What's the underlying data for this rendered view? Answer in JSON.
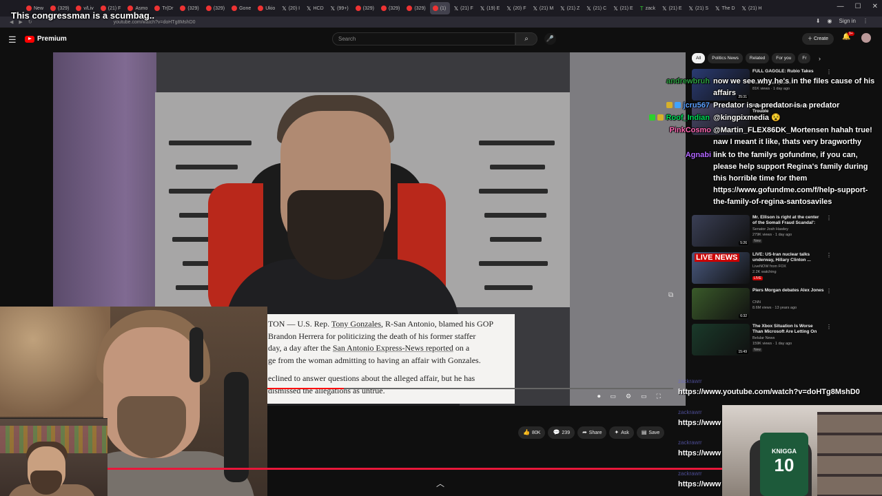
{
  "browser": {
    "tabs": [
      {
        "label": "New",
        "icon": "youtube-icon"
      },
      {
        "label": "(329)",
        "icon": "youtube-icon"
      },
      {
        "label": "v/Liv",
        "icon": "youtube-icon"
      },
      {
        "label": "(21) F",
        "icon": "youtube-icon"
      },
      {
        "label": "Asmo",
        "icon": "youtube-icon"
      },
      {
        "label": "Tr(Dr",
        "icon": "youtube-icon"
      },
      {
        "label": "(329)",
        "icon": "youtube-icon"
      },
      {
        "label": "(329)",
        "icon": "youtube-icon"
      },
      {
        "label": "Gone",
        "icon": "youtube-icon"
      },
      {
        "label": "Ukio",
        "icon": "youtube-icon"
      },
      {
        "label": "(20) I",
        "icon": "x-icon"
      },
      {
        "label": "HCD",
        "icon": "x-icon"
      },
      {
        "label": "(99+)",
        "icon": "x-icon"
      },
      {
        "label": "(329)",
        "icon": "youtube-icon"
      },
      {
        "label": "(329)",
        "icon": "youtube-icon"
      },
      {
        "label": "(329)",
        "icon": "youtube-icon"
      },
      {
        "label": "(1)",
        "icon": "youtube-icon",
        "active": true
      },
      {
        "label": "(21) F",
        "icon": "x-icon"
      },
      {
        "label": "(19) E",
        "icon": "x-icon"
      },
      {
        "label": "(20) F",
        "icon": "x-icon"
      },
      {
        "label": "(21) M",
        "icon": "x-icon"
      },
      {
        "label": "(21) Z",
        "icon": "x-icon"
      },
      {
        "label": "(21) C",
        "icon": "x-icon"
      },
      {
        "label": "(21) E",
        "icon": "x-icon"
      },
      {
        "label": "zack",
        "icon": "tt-icon"
      },
      {
        "label": "(21) E",
        "icon": "x-icon"
      },
      {
        "label": "(21) S",
        "icon": "x-icon"
      },
      {
        "label": "The D",
        "icon": "x-icon"
      },
      {
        "label": "(21) H",
        "icon": "x-icon"
      }
    ],
    "url": "youtube.com/watch?v=doHTg8MshD0",
    "sign_in": "Sign in"
  },
  "stream_title": "This congressman is a scumbag..",
  "youtube": {
    "brand": "Premium",
    "search_placeholder": "Search",
    "create_label": "Create",
    "notif_count": "9+",
    "likes": "80K",
    "comments": "239",
    "share": "Share",
    "ask": "Ask",
    "save": "Save"
  },
  "article": {
    "line1_a": "TON — U.S. Rep. ",
    "line1_link": "Tony Gonzales",
    "line1_b": ", R-San Antonio, blamed his GOP",
    "line2": "Brandon Herrera for politicizing the death of his former staffer",
    "line3_a": "day, a day after the ",
    "line3_link": "San Antonio Express-News reported",
    "line3_b": " on a",
    "line4": "ge from the woman admitting to having an affair with Gonzales.",
    "line5": "eclined to answer questions about the alleged affair, but he has",
    "line6": "dismissed the allegations as untrue."
  },
  "video_progress": 0.19,
  "chips": [
    "All",
    "Politics News",
    "Related",
    "For you",
    "Fr"
  ],
  "recommendations": [
    {
      "title": "FULL GAGGLE: Rubio Takes",
      "channel": "Forbes Breaking News",
      "meta": "81K views · 1 day ago",
      "duration": "25:31",
      "color": "#2a3b73"
    },
    {
      "title": "Ilhan Omar Is Suddenly In Trouble",
      "channel": "",
      "meta": "",
      "duration": "",
      "color": "#4a4a6a"
    },
    {
      "title": "Mr. Ellison is right at the center of the Somali Fraud Scandal':",
      "channel": "Senator Josh Hawley",
      "meta": "279K views · 1 day ago",
      "duration": "5:26",
      "badge": "New",
      "color": "#3a3f55"
    },
    {
      "title": "LIVE: US-Iran nuclear talks underway, Hillary Clinton ...",
      "channel": "LiveNOW from FOX",
      "meta": "2.2K watching",
      "duration": "",
      "badge": "LIVE",
      "color": "#4a5a80",
      "live_text": "LIVE NEWS"
    },
    {
      "title": "Piers Morgan debates Alex Jones",
      "channel": "CNN",
      "meta": "8.6M views · 13 years ago",
      "duration": "6:32",
      "color": "#3a5a2a"
    },
    {
      "title": "The Xbox Situation Is Worse Than Microsoft Are Letting On",
      "channel": "Belular News",
      "meta": "159K views · 1 day ago",
      "duration": "15:49",
      "badge": "New",
      "color": "#1a3a2a"
    }
  ],
  "chat": [
    {
      "name": "andrewbruh",
      "color": "#2ea043",
      "badges": [],
      "msg": "now we see why he's in the files cause of his affairs"
    },
    {
      "name": "jcru567",
      "color": "#5aa0ff",
      "badges": [
        "#d6b02a",
        "#3fa3ff"
      ],
      "msg": "Predator is a predator is a predator"
    },
    {
      "name": "Roof_Indian",
      "color": "#00e05a",
      "badges": [
        "#2dd02d",
        "#d6b02a"
      ],
      "msg": "@kingpixmedia 😵"
    },
    {
      "name": "PinkCosmo",
      "color": "#ff69b4",
      "badges": [],
      "msg": "@Martin_FLEX86DK_Mortensen hahah true! naw I meant it like, thats very bragworthy"
    },
    {
      "name": "Agnabi",
      "color": "#b266ff",
      "badges": [],
      "msg": "link to the familys gofundme, if you can, please help support Regina's family during this horrible time for them https://www.gofundme.com/f/help-support-the-family-of-regina-santosaviles"
    }
  ],
  "url_messages": [
    {
      "name": "zackrawrr",
      "text": "https://www.youtube.com/watch?v=doHTg8MshD0"
    },
    {
      "name": "zackrawrr",
      "text": "https://www"
    },
    {
      "name": "zackrawrr",
      "text": "https://www"
    },
    {
      "name": "zackrawrr",
      "text": "https://www"
    }
  ],
  "webcam": {
    "jersey_name": "KNIGGA",
    "jersey_number": "10"
  },
  "colors": {
    "accent": "#ff0000",
    "stream_bar": "#e8173a"
  }
}
